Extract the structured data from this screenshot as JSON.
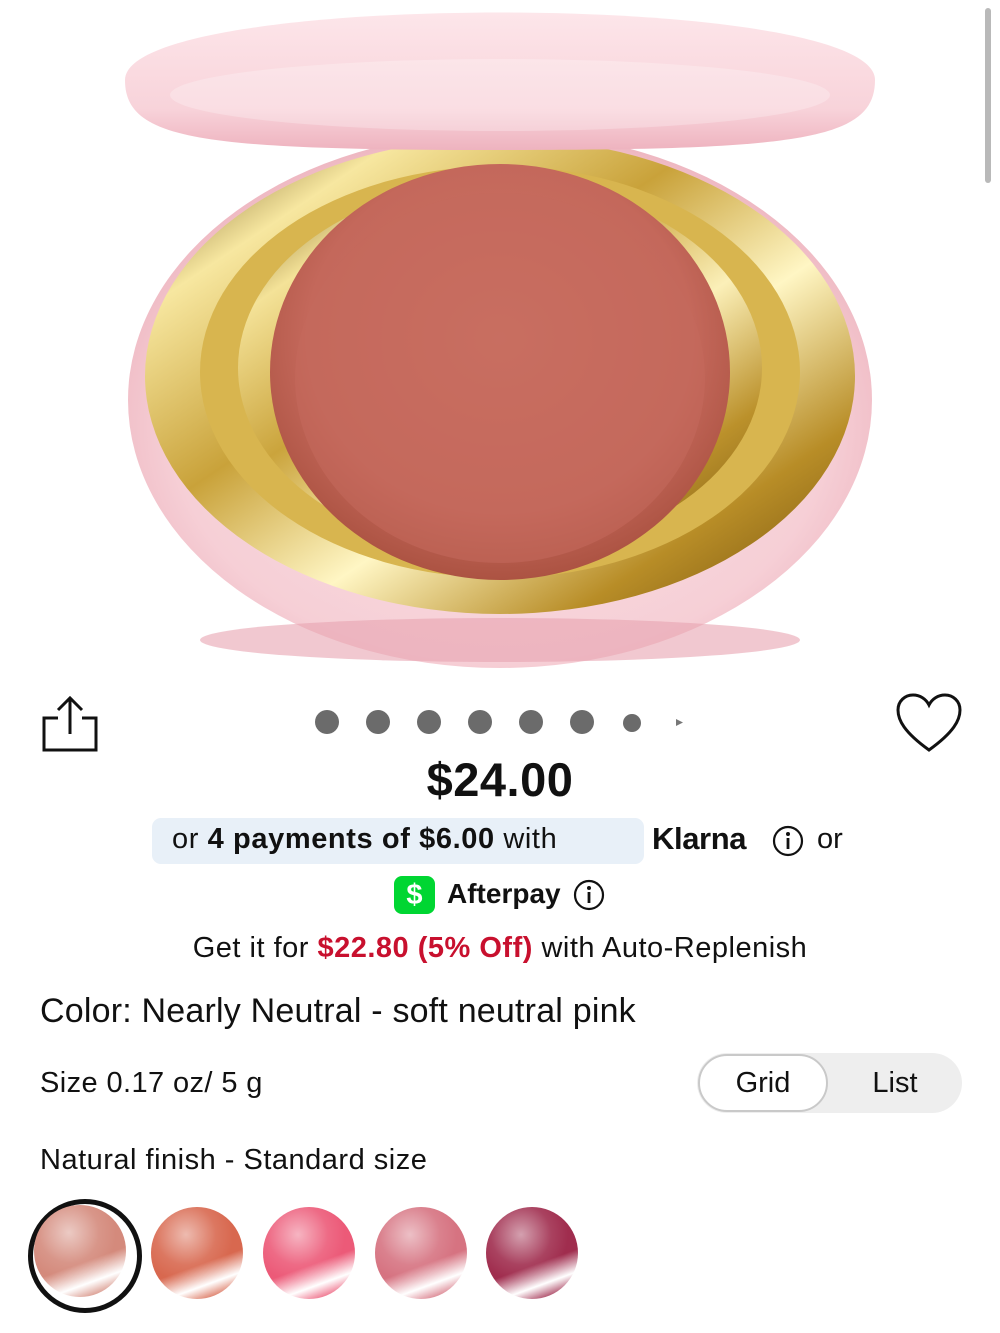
{
  "carousel": {
    "dot_count": 8
  },
  "price": "$24.00",
  "payments": {
    "klarna_prefix": "or ",
    "klarna_bold": "4 payments of $6.00",
    "klarna_suffix": " with",
    "klarna_brand": "Klarna",
    "or_label": "or",
    "afterpay_brand": "Afterpay",
    "cashapp_symbol": "$"
  },
  "auto_replenish": {
    "prefix": "Get it for ",
    "discount": "$22.80 (5% Off)",
    "suffix": " with Auto-Replenish"
  },
  "color": {
    "label": "Color: Nearly Neutral - soft neutral pink"
  },
  "size": {
    "label": "Size 0.17 oz/ 5 g"
  },
  "view_toggle": {
    "grid_label": "Grid",
    "list_label": "List",
    "selected": "Grid"
  },
  "finish": {
    "label": "Natural finish - Standard size"
  },
  "swatches": [
    {
      "name": "Nearly Neutral",
      "color": "#d48a7c",
      "selected": true
    },
    {
      "name": "swatch-2",
      "color": "#d8684f",
      "selected": false
    },
    {
      "name": "swatch-3",
      "color": "#ec5a78",
      "selected": false
    },
    {
      "name": "swatch-4",
      "color": "#d67381",
      "selected": false
    },
    {
      "name": "swatch-5",
      "color": "#a02d4e",
      "selected": false
    }
  ],
  "colors": {
    "accent_red": "#c8102e",
    "klarna_bg": "#e8f0f8",
    "cashapp_green": "#00d632"
  },
  "icons": [
    "share-icon",
    "heart-icon",
    "info-icon",
    "cashapp-icon"
  ]
}
